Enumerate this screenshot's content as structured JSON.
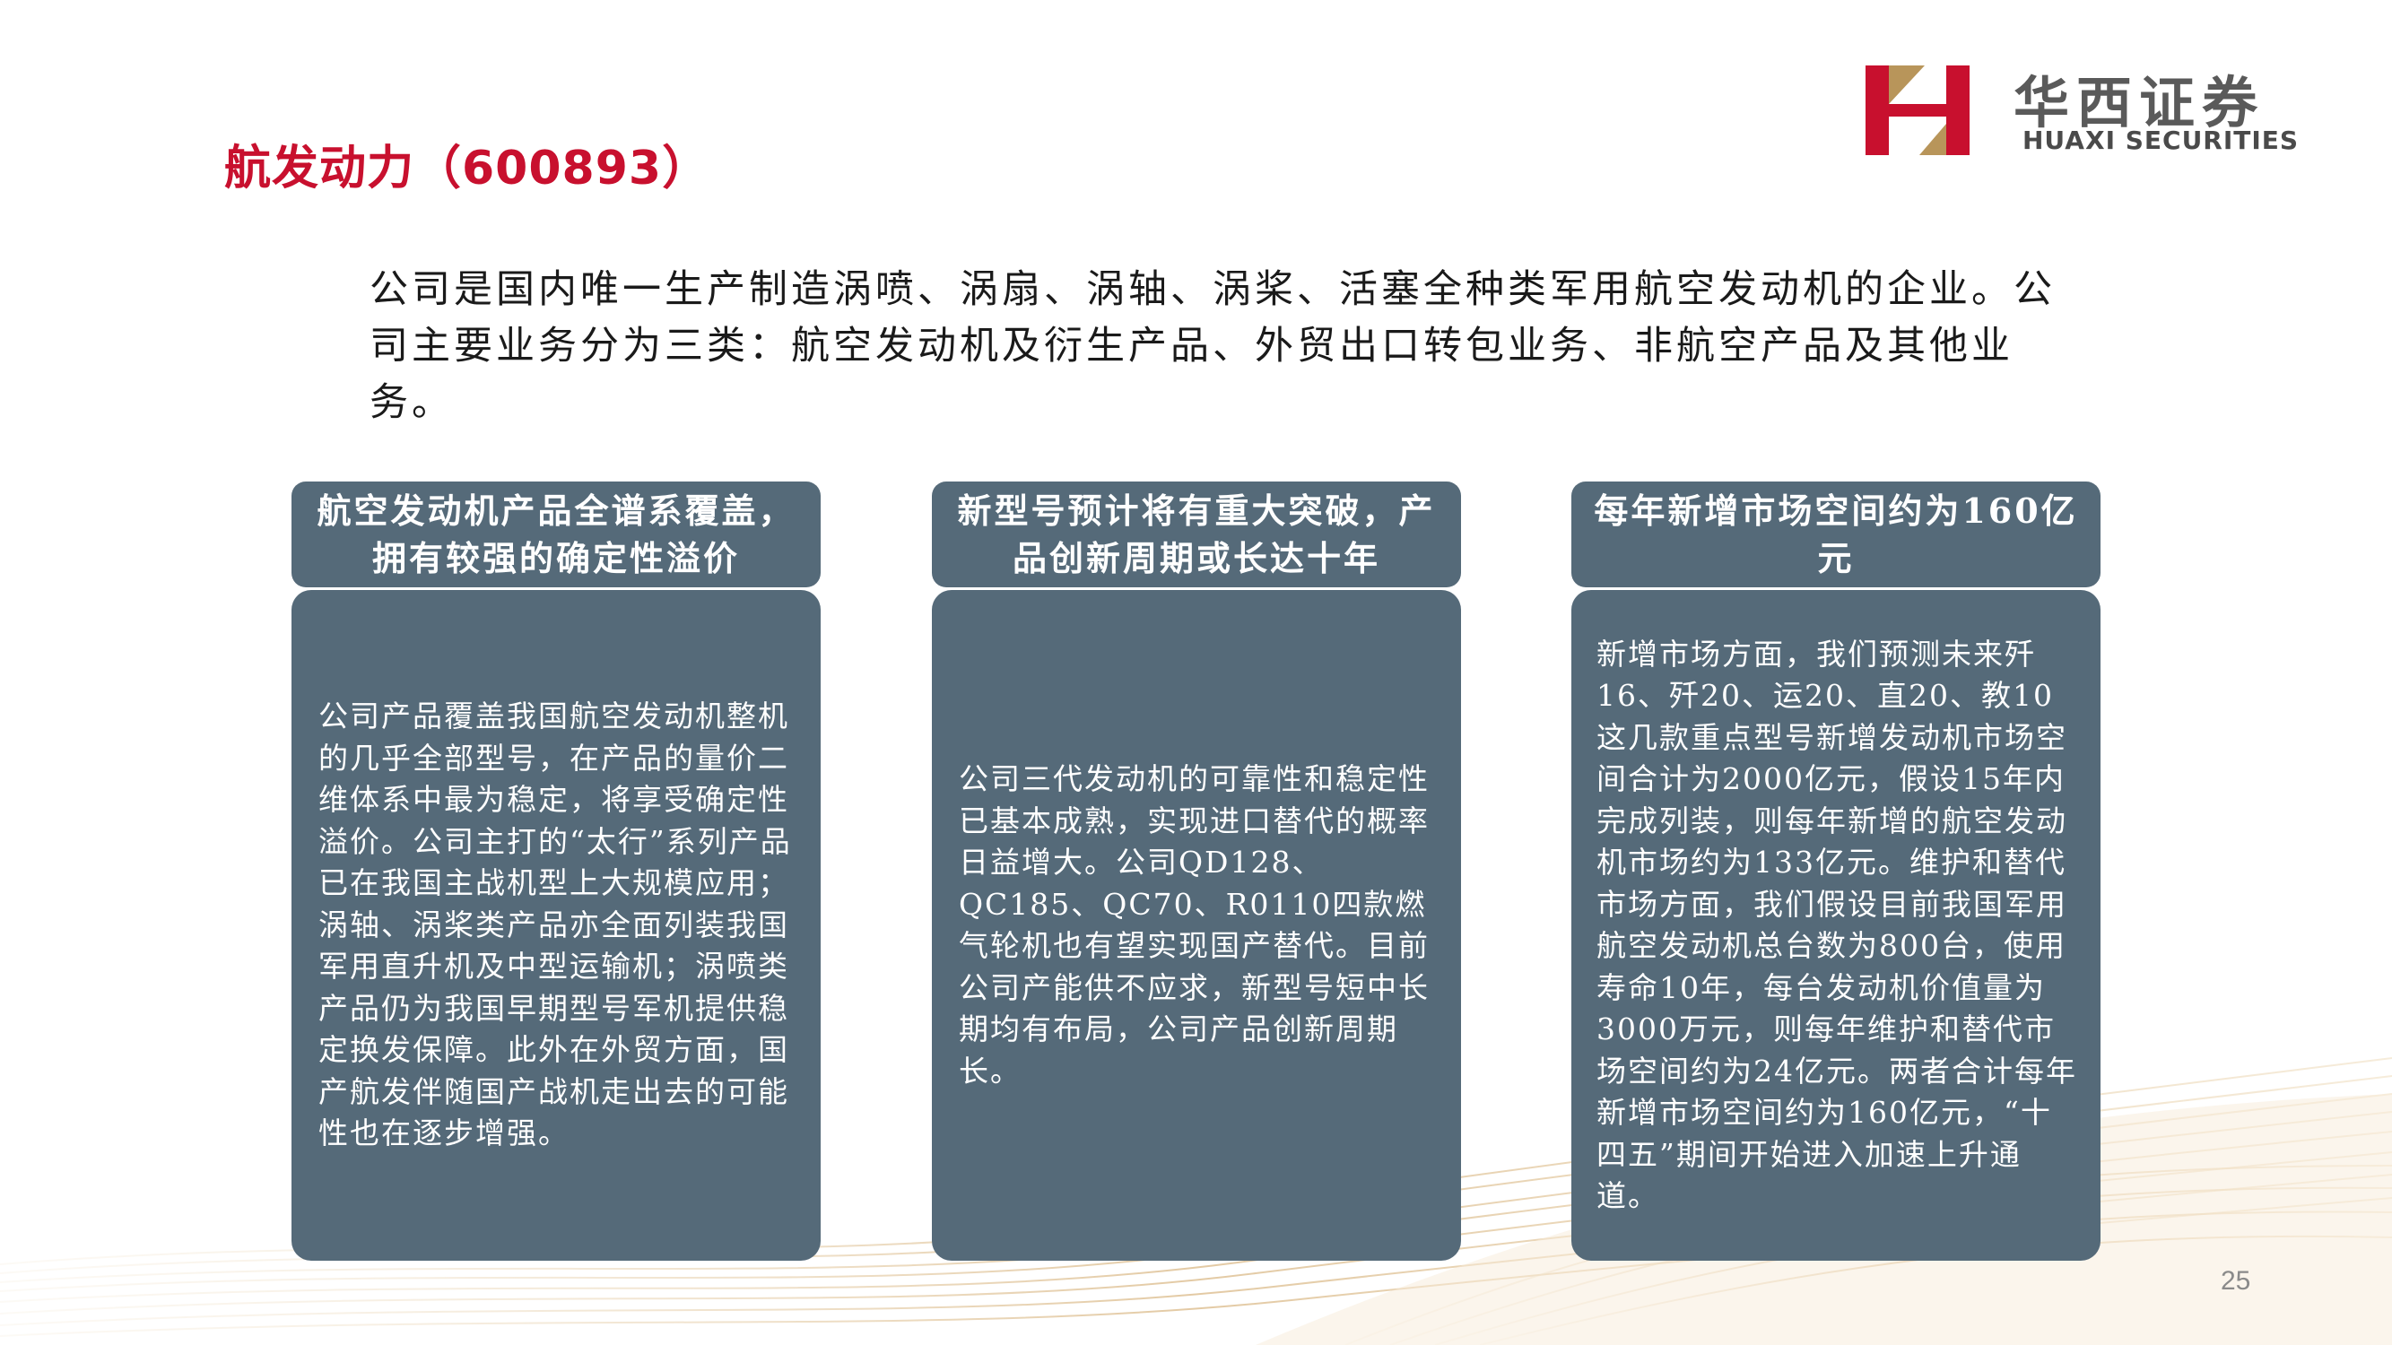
{
  "title": "航发动力（600893）",
  "logo": {
    "cn": "华西证券",
    "en": "HUAXI SECURITIES",
    "brand_red": "#c8102e",
    "brand_gold": "#b8955a"
  },
  "intro": "公司是国内唯一生产制造涡喷、涡扇、涡轴、涡桨、活塞全种类军用航空发动机的企业。公司主要业务分为三类：航空发动机及衍生产品、外贸出口转包业务、非航空产品及其他业务。",
  "columns": [
    {
      "heading": "航空发动机产品全谱系覆盖，拥有较强的确定性溢价",
      "body": "公司产品覆盖我国航空发动机整机的几乎全部型号，在产品的量价二维体系中最为稳定，将享受确定性溢价。公司主打的“太行”系列产品已在我国主战机型上大规模应用；涡轴、涡桨类产品亦全面列装我国军用直升机及中型运输机；涡喷类产品仍为我国早期型号军机提供稳定换发保障。此外在外贸方面，国产航发伴随国产战机走出去的可能性也在逐步增强。"
    },
    {
      "heading": "新型号预计将有重大突破，产品创新周期或长达十年",
      "body": "公司三代发动机的可靠性和稳定性已基本成熟，实现进口替代的概率日益增大。公司QD128、QC185、QC70、R0110四款燃气轮机也有望实现国产替代。目前公司产能供不应求，新型号短中长期均有布局，公司产品创新周期长。"
    },
    {
      "heading": "每年新增市场空间约为160亿元",
      "body": "新增市场方面，我们预测未来歼16、歼20、运20、直20、教10这几款重点型号新增发动机市场空间合计为2000亿元，假设15年内完成列装，则每年新增的航空发动机市场约为133亿元。维护和替代市场方面，我们假设目前我国军用航空发动机总台数为800台，使用寿命10年，每台发动机价值量为3000万元，则每年维护和替代市场空间约为24亿元。两者合计每年新增市场空间约为160亿元，“十四五”期间开始进入加速上升通道。"
    }
  ],
  "page_number": "25",
  "colors": {
    "panel": "#556a79",
    "title": "#c8102e",
    "wave": "#e2c9a0"
  }
}
